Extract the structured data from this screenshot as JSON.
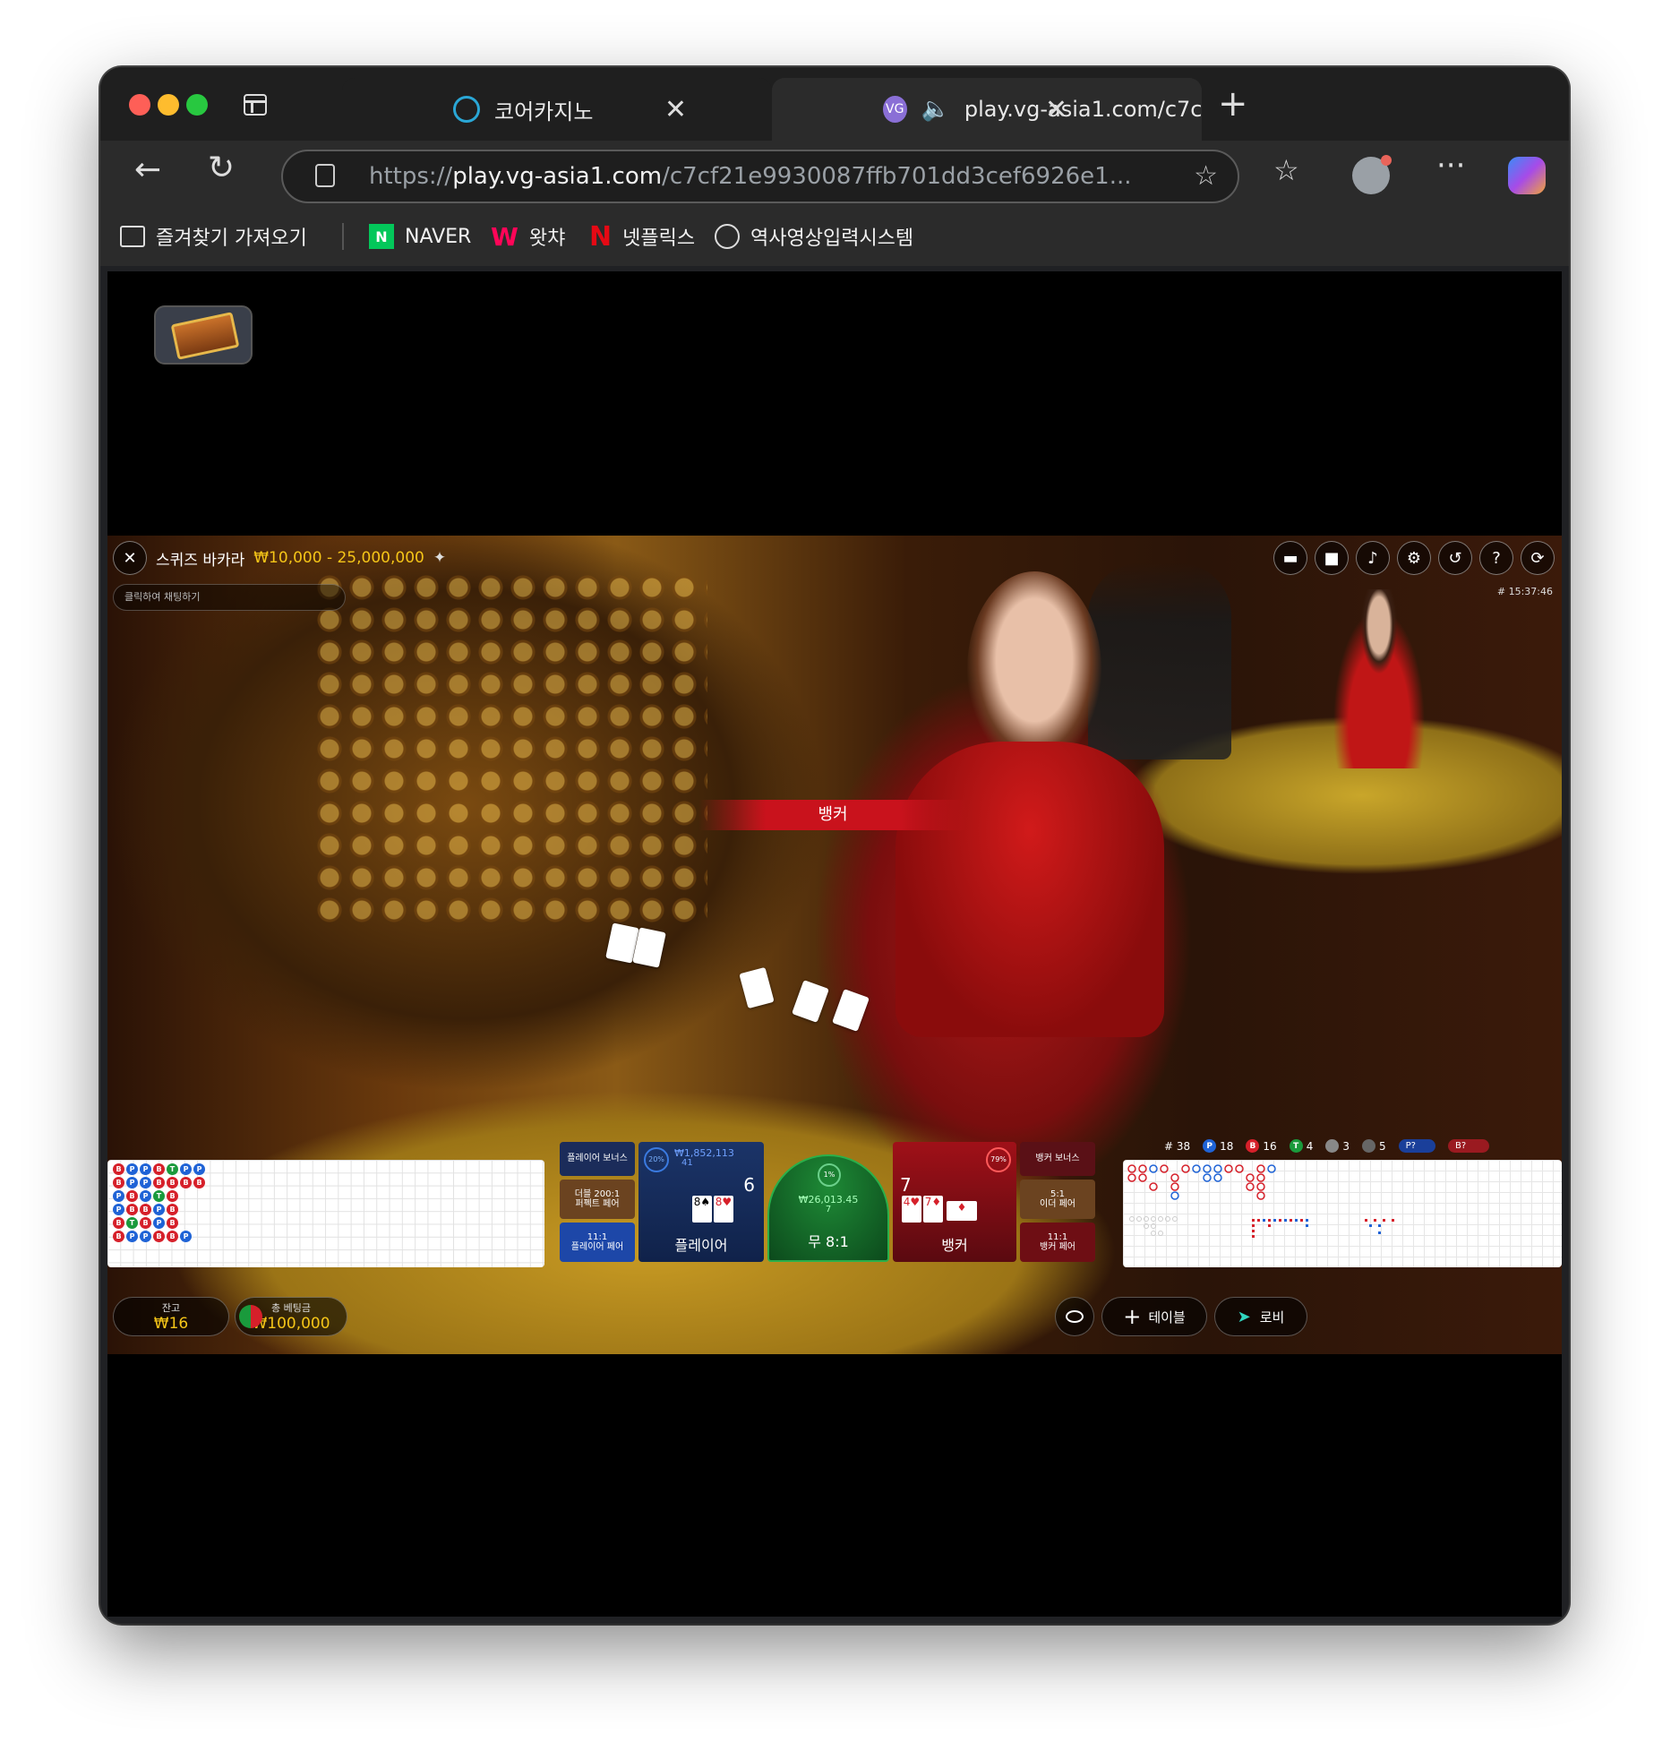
{
  "browser": {
    "tabs": [
      {
        "title": "코어카지노",
        "active": false
      },
      {
        "title": "play.vg-asia1.com/c7cf21e",
        "active": true,
        "badge": "VG"
      }
    ],
    "address": {
      "prefix": "https://",
      "host": "play.vg-asia1.com",
      "path": "/c7cf21e9930087ffb701dd3cef6926e1..."
    },
    "bookmarks": [
      {
        "label": "즐겨찾기 가져오기",
        "icon": "import-favorites-icon"
      },
      {
        "label": "NAVER",
        "icon": "naver-icon"
      },
      {
        "label": "왓챠",
        "icon": "watcha-icon"
      },
      {
        "label": "넷플릭스",
        "icon": "netflix-icon"
      },
      {
        "label": "역사영상입력시스템",
        "icon": "globe-icon"
      }
    ]
  },
  "game": {
    "title": "스퀴즈 바카라",
    "limits": "₩10,000 - 25,000,000",
    "chat_placeholder": "클릭하여 채팅하기",
    "time": "# 15:37:46",
    "result_banner": "뱅커",
    "stats": {
      "rounds": "# 38",
      "player": "18",
      "banker": "16",
      "tie": "4",
      "player_pair": "3",
      "banker_pair": "5",
      "player_ask": "P?",
      "banker_ask": "B?"
    },
    "bets": {
      "player_bonus": "플레이어 보너스",
      "perfect_pair_line1": "더블 200:1",
      "perfect_pair_line2": "퍼펙트 페어",
      "player_pair_odds": "11:1",
      "player_pair": "플레이어 페어",
      "player_label": "플레이어",
      "player_score": "6",
      "player_amount": "₩1,852,113",
      "player_count": "41",
      "player_pct": "20%",
      "tie_label": "무 8:1",
      "tie_amount": "₩26,013.45",
      "tie_count": "7",
      "tie_pct": "1%",
      "banker_label": "뱅커",
      "banker_score": "7",
      "banker_pct": "79%",
      "banker_bonus": "뱅커 보너스",
      "either_pair_odds": "5:1",
      "either_pair": "이더 페어",
      "banker_pair_odds": "11:1",
      "banker_pair": "뱅커 페어"
    },
    "player_cards": [
      "8♠",
      "8♥"
    ],
    "banker_cards": [
      "4♥",
      "7♦",
      "♦"
    ],
    "bead_road": [
      [
        "B",
        "P",
        "P",
        "B",
        "T",
        "P",
        "P"
      ],
      [
        "B",
        "P",
        "P",
        "B",
        "B",
        "B",
        "B"
      ],
      [
        "P",
        "B",
        "P",
        "T",
        "B",
        "",
        ""
      ],
      [
        "P",
        "B",
        "B",
        "P",
        "B",
        "",
        ""
      ],
      [
        "B",
        "T",
        "B",
        "P",
        "B",
        "",
        ""
      ],
      [
        "B",
        "P",
        "P",
        "B",
        "B",
        "P",
        ""
      ]
    ],
    "balance_label": "잔고",
    "balance": "₩16",
    "total_bet_label": "총 베팅금",
    "total_bet": "₩100,000",
    "table_button": "테이블",
    "lobby_button": "로비"
  },
  "colors": {
    "player": "#1f63d6",
    "banker": "#d6202a",
    "tie": "#1a9a3c",
    "gold": "#f5c518"
  }
}
